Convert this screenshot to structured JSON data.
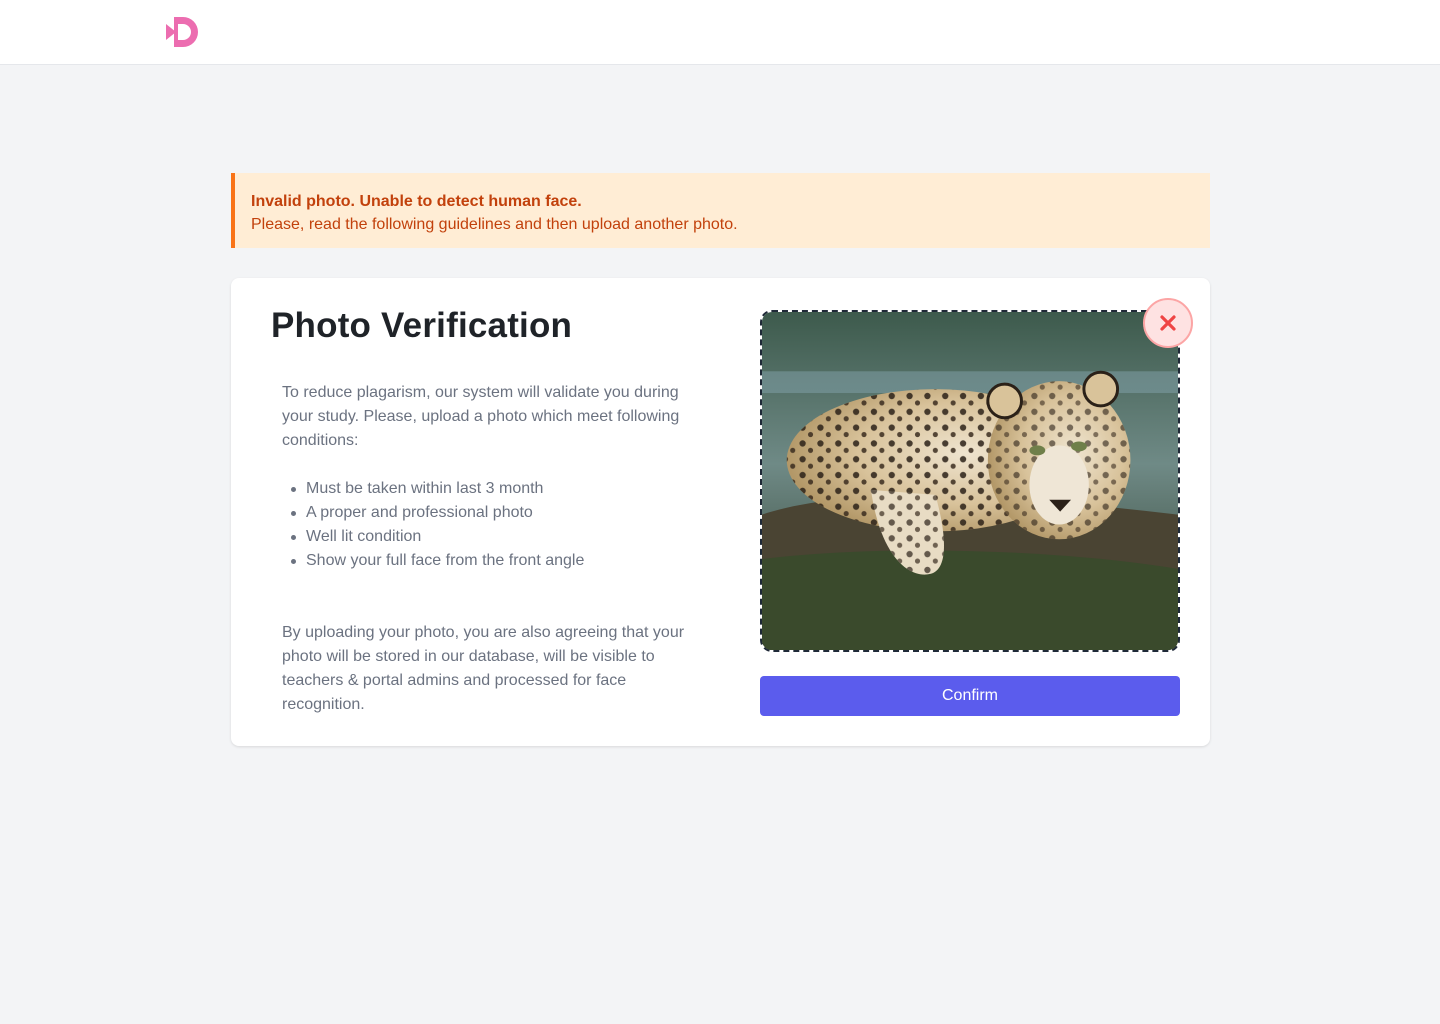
{
  "header": {
    "logo_icon": "brand-logo-icon",
    "brand_color": "#ec6db0"
  },
  "alert": {
    "title": "Invalid photo. Unable to detect human face.",
    "message": "Please, read the following guidelines and then upload another photo.",
    "color": "#c2410c"
  },
  "card": {
    "title": "Photo Verification",
    "intro": "To reduce plagarism, our system will validate you during your study. Please, upload a photo which meet following conditions:",
    "conditions": [
      "Must be taken within last 3 month",
      "A proper and professional photo",
      "Well lit condition",
      "Show your full face from the front angle"
    ],
    "consent": "By uploading your photo, you are also agreeing that your photo will be stored in our database, will be visible to teachers & portal admins and processed for face recognition.",
    "photo_alt": "Uploaded photo: leopard resting on a log",
    "remove_icon": "close-icon",
    "confirm_label": "Confirm",
    "accent": "#5b5ced"
  }
}
